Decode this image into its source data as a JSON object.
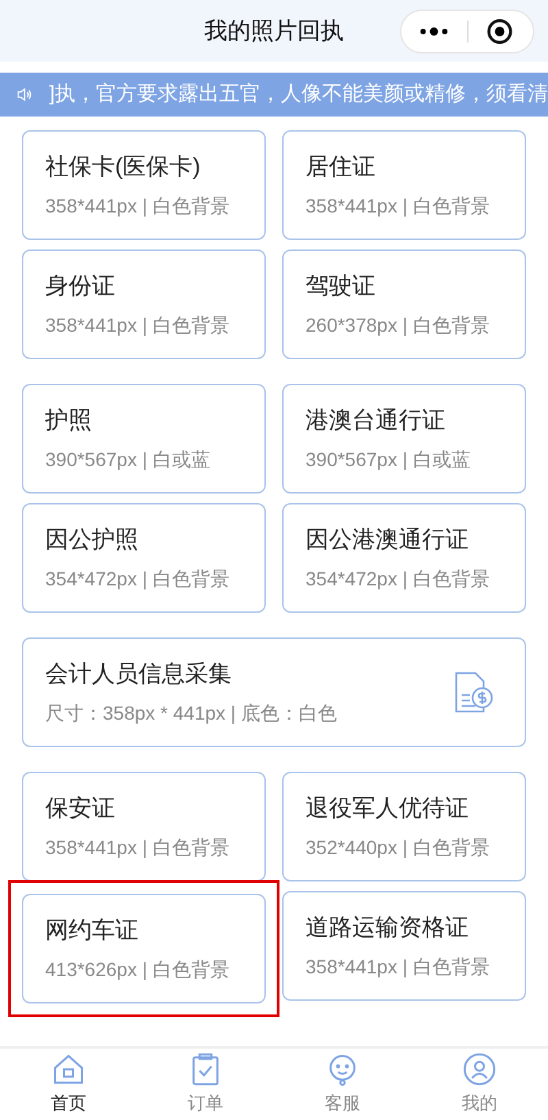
{
  "header": {
    "title": "我的照片回执"
  },
  "notice": {
    "text": "]执，官方要求露出五官，人像不能美颜或精修，须看清"
  },
  "sections": [
    {
      "kind": "grid",
      "cards": [
        {
          "name": "社保卡(医保卡)",
          "spec": "358*441px | 白色背景",
          "highlighted": false
        },
        {
          "name": "居住证",
          "spec": "358*441px | 白色背景",
          "highlighted": false
        },
        {
          "name": "身份证",
          "spec": "358*441px | 白色背景",
          "highlighted": false
        },
        {
          "name": "驾驶证",
          "spec": "260*378px | 白色背景",
          "highlighted": false
        }
      ]
    },
    {
      "kind": "grid",
      "cards": [
        {
          "name": "护照",
          "spec": "390*567px | 白或蓝",
          "highlighted": false
        },
        {
          "name": "港澳台通行证",
          "spec": "390*567px | 白或蓝",
          "highlighted": false
        },
        {
          "name": "因公护照",
          "spec": "354*472px | 白色背景",
          "highlighted": false
        },
        {
          "name": "因公港澳通行证",
          "spec": "354*472px | 白色背景",
          "highlighted": false
        }
      ]
    },
    {
      "kind": "wide",
      "cards": [
        {
          "name": "会计人员信息采集",
          "spec": "尺寸：358px * 441px | 底色：白色",
          "highlighted": false
        }
      ]
    },
    {
      "kind": "grid",
      "cards": [
        {
          "name": "保安证",
          "spec": "358*441px | 白色背景",
          "highlighted": false
        },
        {
          "name": "退役军人优待证",
          "spec": "352*440px | 白色背景",
          "highlighted": false
        },
        {
          "name": "网约车证",
          "spec": "413*626px | 白色背景",
          "highlighted": true
        },
        {
          "name": "道路运输资格证",
          "spec": "358*441px | 白色背景",
          "highlighted": false
        }
      ]
    }
  ],
  "nav": [
    {
      "label": "首页",
      "selected": true
    },
    {
      "label": "订单",
      "selected": false
    },
    {
      "label": "客服",
      "selected": false
    },
    {
      "label": "我的",
      "selected": false
    }
  ]
}
